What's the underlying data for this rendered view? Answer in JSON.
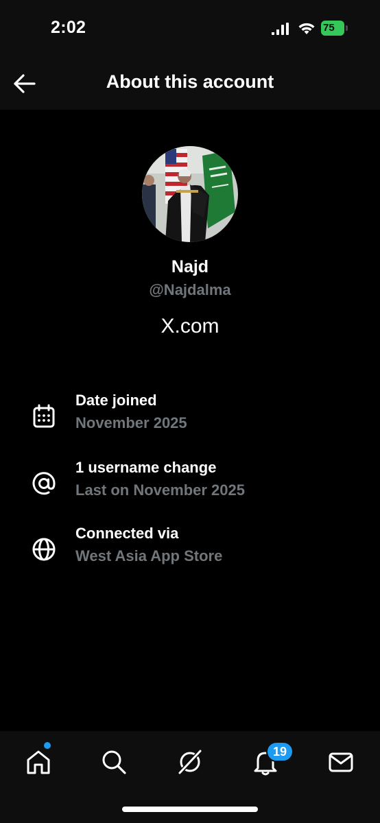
{
  "status_bar": {
    "time": "2:02",
    "battery_level": "75",
    "battery_color": "#35c759"
  },
  "header": {
    "title": "About this account",
    "back_icon": "arrow-left-icon"
  },
  "profile": {
    "display_name": "Najd",
    "handle": "@Najdalma",
    "site": "X.com"
  },
  "info": [
    {
      "icon": "calendar-icon",
      "title": "Date joined",
      "value": "November 2025"
    },
    {
      "icon": "at-sign-icon",
      "title": "1 username change",
      "value": "Last on November 2025"
    },
    {
      "icon": "globe-icon",
      "title": "Connected via",
      "value": "West Asia App Store"
    }
  ],
  "bottom_nav": {
    "items": [
      "home-icon",
      "search-icon",
      "grok-icon",
      "bell-icon",
      "mail-icon"
    ],
    "notifications_count": "19",
    "accent_color": "#1d9bf0"
  },
  "colors": {
    "background": "#000000",
    "bar_background": "#0e0e0e",
    "text_primary": "#ffffff",
    "text_secondary": "#71767b"
  }
}
